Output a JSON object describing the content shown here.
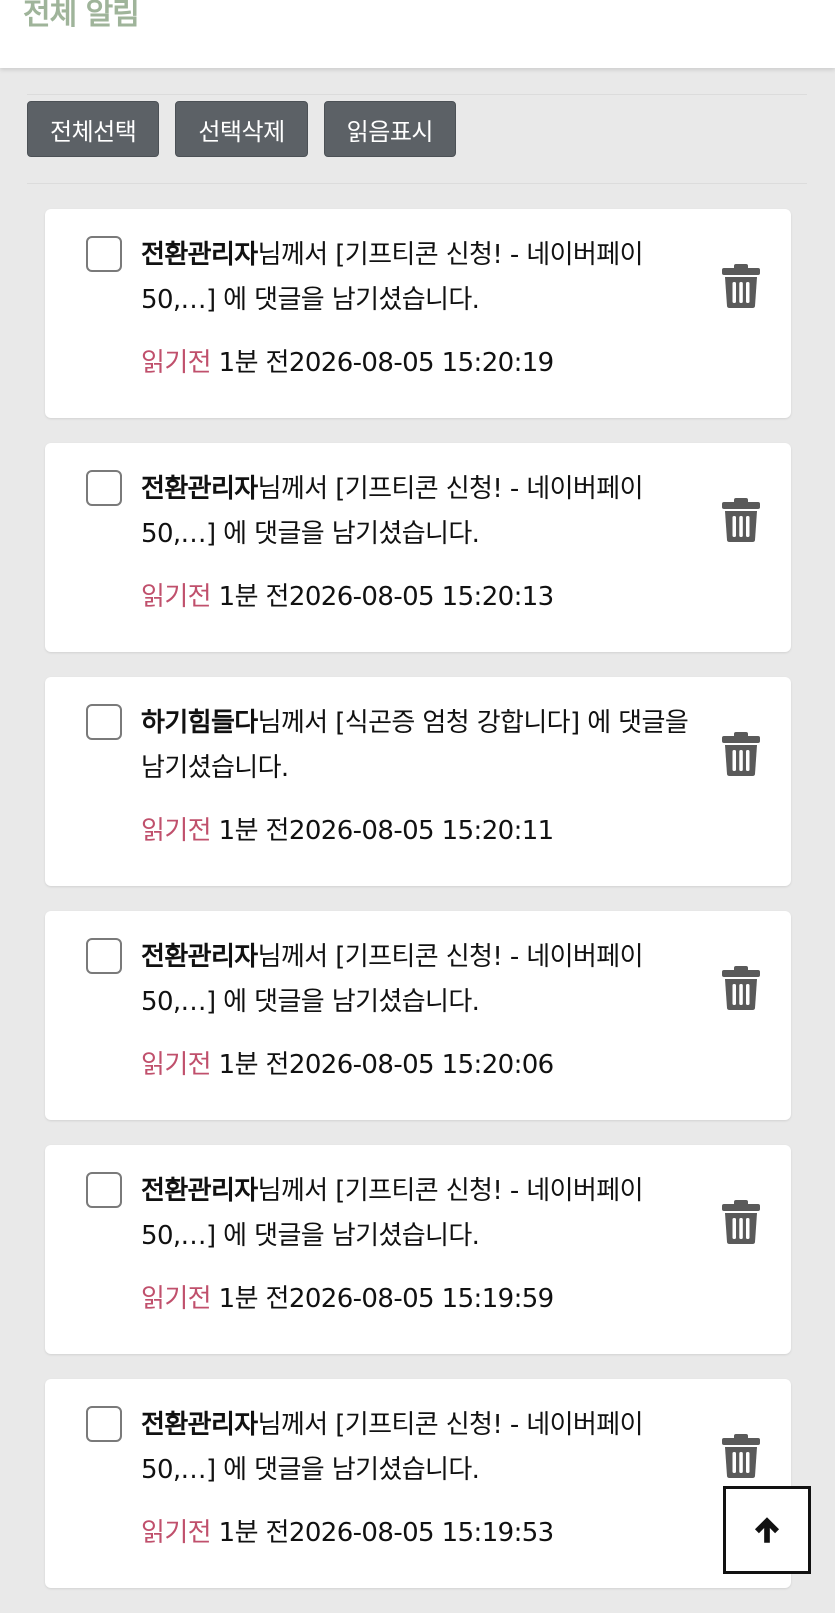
{
  "header": {
    "title": "전체 알림"
  },
  "toolbar": {
    "select_all": "전체선택",
    "delete_selected": "선택삭제",
    "mark_read": "읽음표시"
  },
  "notifications": [
    {
      "user": "전환관리자",
      "text": "님께서 [기프티콘 신청! - 네이버페이 50,…] 에 댓글을 남기셨습니다.",
      "status": "읽기전",
      "time": " 1분 전2026-08-05 15:20:19"
    },
    {
      "user": "전환관리자",
      "text": "님께서 [기프티콘 신청! - 네이버페이 50,…] 에 댓글을 남기셨습니다.",
      "status": "읽기전",
      "time": " 1분 전2026-08-05 15:20:13"
    },
    {
      "user": "하기힘들다",
      "text": "님께서 [식곤증 엄청 강합니다] 에 댓글을 남기셨습니다.",
      "status": "읽기전",
      "time": " 1분 전2026-08-05 15:20:11"
    },
    {
      "user": "전환관리자",
      "text": "님께서 [기프티콘 신청! - 네이버페이 50,…] 에 댓글을 남기셨습니다.",
      "status": "읽기전",
      "time": " 1분 전2026-08-05 15:20:06"
    },
    {
      "user": "전환관리자",
      "text": "님께서 [기프티콘 신청! - 네이버페이 50,…] 에 댓글을 남기셨습니다.",
      "status": "읽기전",
      "time": " 1분 전2026-08-05 15:19:59"
    },
    {
      "user": "전환관리자",
      "text": "님께서 [기프티콘 신청! - 네이버페이 50,…] 에 댓글을 남기셨습니다.",
      "status": "읽기전",
      "time": " 1분 전2026-08-05 15:19:53"
    }
  ],
  "colors": {
    "title": "#9fb49a",
    "unread": "#c0506c",
    "button_bg": "#5c6166",
    "icon": "#5a5a5a"
  },
  "icons": {
    "delete": "trash-icon",
    "scroll_top": "arrow-up-icon"
  }
}
